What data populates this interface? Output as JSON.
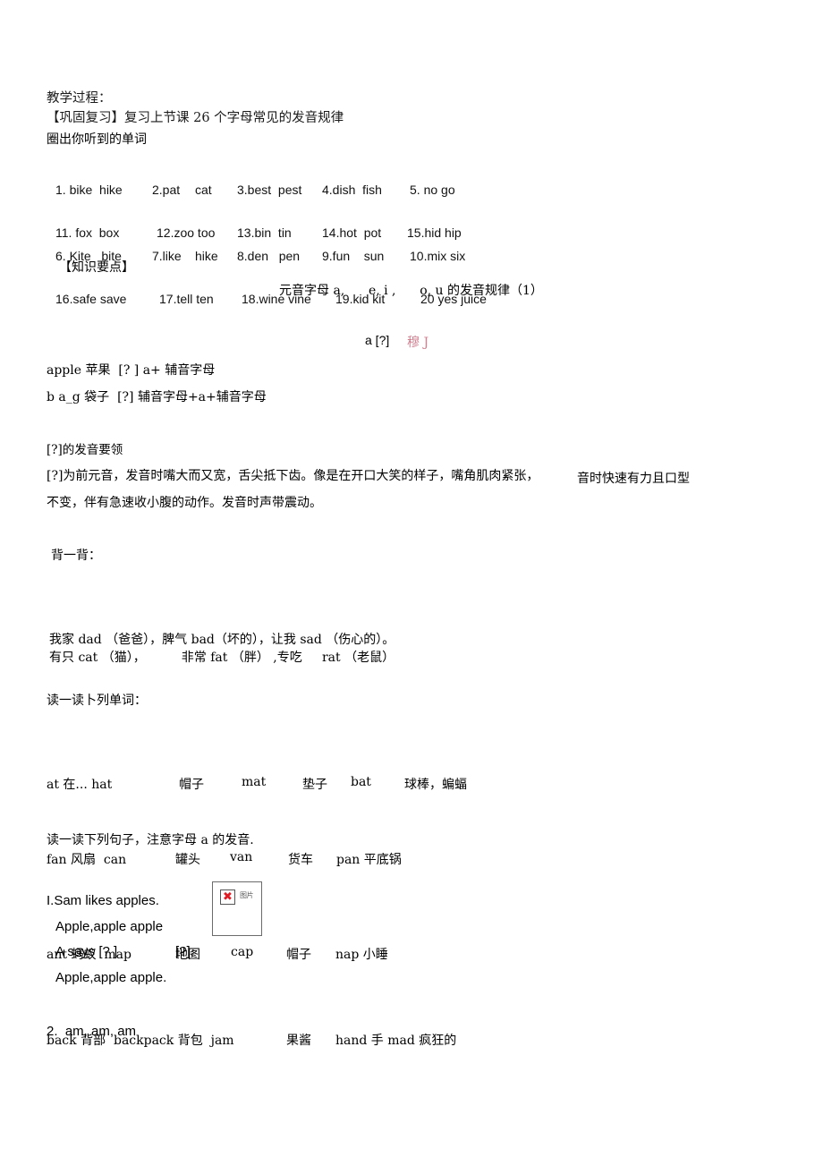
{
  "document": {
    "title": "教学过程：",
    "review_heading": "【巩固复习】复习上节课 26 个字母常见的发音规律",
    "instruction_circle": "圈出你听到的单词"
  },
  "word_lists": {
    "group1": [
      [
        "1. bike  hike",
        "2.pat",
        "cat",
        "3.best  pest",
        "4.dish  fish",
        "5. no go"
      ],
      [
        "6. Kite   bite",
        "7.like",
        "hike",
        "8.den   pen",
        "9.fun    sun",
        "10.mix six"
      ]
    ],
    "group2": [
      [
        "11. fox  box",
        "12.zoo too",
        "13.bin  tin",
        "14.hot  pot",
        "15.hid hip"
      ],
      [
        "16.safe save",
        "17.tell ten",
        "18.wine vine",
        "19.kid kit",
        "20 yes juice"
      ]
    ]
  },
  "key_points": {
    "heading": "【知识要点】",
    "rule_title": "元音字母 a,      e, i ,      o, u 的发音规律（1）",
    "phoneme_line": "a [?]",
    "red_note": "穆 J"
  },
  "examples": {
    "apple_line": "apple 苹果  [? ] a+ 辅音字母",
    "bag_line": "b a_g 袋子  [?] 辅音字母+a+辅音字母"
  },
  "pronunciation": {
    "heading": "[?]的发音要领",
    "body_line1": "[?]为前元音，发音时嘴大而又宽，舌尖抵下齿。像是在开口大笑的样子，嘴角肌肉紧张，",
    "body_right": "音时快速有力且口型",
    "body_line2": "不变，伴有急速收小腹的动作。发音时声带震动。"
  },
  "recite": {
    "heading": "背一背：",
    "line1": "我家 dad （爸爸），脾气 bad（坏的），让我 sad （伤心的）。",
    "line2": "有只 cat （猫），         非常 fat （胖） ,专吃     rat （老鼠）"
  },
  "read_words": {
    "heading": "读一读卜列单词：",
    "rows": [
      [
        "at 在... hat",
        "帽子",
        "mat",
        "垫子",
        "bat",
        "球棒，蝙蝠"
      ],
      [
        "fan 风扇  can",
        "罐头",
        "van",
        "货车",
        "pan 平底锅",
        ""
      ],
      [
        "ant 蚂蚁  map",
        "地图",
        "cap",
        "帽子",
        "nap 小睡",
        ""
      ],
      [
        "back 背部  backpack 背包  jam",
        "",
        "",
        "果酱",
        "hand 手 mad 疯狂的",
        ""
      ]
    ]
  },
  "read_sentences": {
    "heading": "读一读下列句子，注意字母 a 的发音.",
    "item1": {
      "line1": "I.Sam likes apples.",
      "line2": "Apple,apple apple",
      "line3a": "A says [? ]",
      "line3b": "[?],",
      "line4": "Apple,apple apple."
    },
    "item2": "2.  am, am, am"
  },
  "broken_image": {
    "alt_text": "图片",
    "icon": "broken-image-icon",
    "x_glyph": "✖"
  },
  "colors": {
    "text": "#000000",
    "red_note": "#cf7f8f",
    "broken_x": "#e01b24",
    "border": "#6b6b6b"
  }
}
